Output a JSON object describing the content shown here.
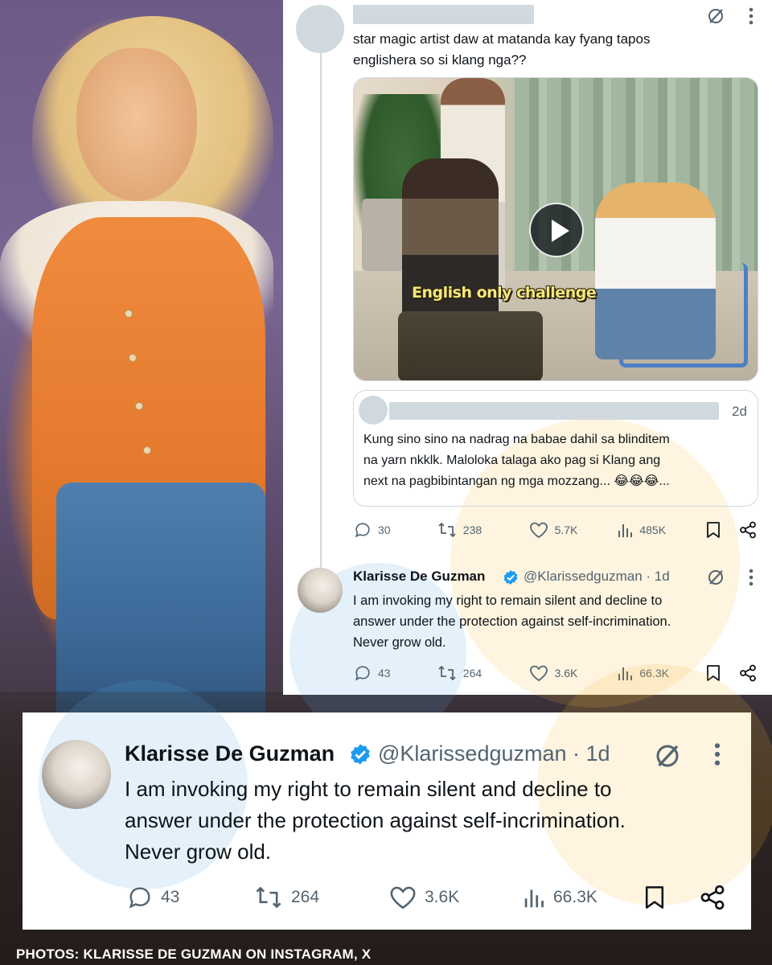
{
  "top_post": {
    "text": "star magic artist daw at matanda kay fyang tapos\nenglishera so si klang nga??",
    "video_caption": "English only challenge"
  },
  "quoted_post": {
    "time": "2d",
    "text": "Kung sino sino na nadrag na babae dahil sa blinditem\nna yarn nkklk. Maloloka talaga ako pag si Klang ang\nnext na pagbibintangan ng mga mozzang... 😂😂😂..."
  },
  "top_post_stats": {
    "replies": "30",
    "reposts": "238",
    "likes": "5.7K",
    "views": "485K"
  },
  "reply_post": {
    "name": "Klarisse De Guzman",
    "handle": "@Klarissedguzman · 1d",
    "text": "I am invoking my right to remain silent and decline to\nanswer under the protection against self-incrimination.\nNever grow old.",
    "replies": "43",
    "reposts": "264",
    "likes": "3.6K",
    "views": "66.3K"
  },
  "zoom_post": {
    "name": "Klarisse De Guzman",
    "handle": "@Klarissedguzman · 1d",
    "text": "I am invoking my right to remain silent and decline to\nanswer under the protection against self-incrimination.\nNever grow old.",
    "replies": "43",
    "reposts": "264",
    "likes": "3.6K",
    "views": "66.3K"
  },
  "credit": "PHOTOS: KLARISSE DE GUZMAN ON INSTAGRAM, X",
  "colors": {
    "text": "#0f1419",
    "secondary": "#536471",
    "verified": "#1d9bf0",
    "border": "#cfd9de",
    "vest": "#e47a2e"
  },
  "icons": [
    "reply-icon",
    "repost-icon",
    "like-icon",
    "views-icon",
    "bookmark-icon",
    "share-icon",
    "grok-icon",
    "more-icon",
    "verified-badge-icon",
    "play-icon"
  ]
}
